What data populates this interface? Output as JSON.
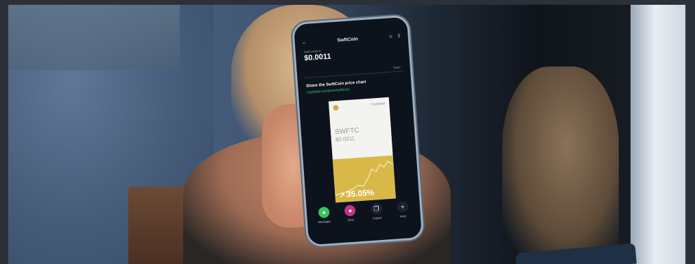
{
  "phone": {
    "app_title": "SwftCoin",
    "coin_name": "SwftCoinprice",
    "price": "$0.0011",
    "change": "",
    "share_tab": "Share",
    "share_title": "Share the SwftCoin price chart",
    "share_link": "cryptokai.com/price/swftcoin",
    "card": {
      "brand": "Cryptokai",
      "ticker": "SWFTC",
      "price": "$0.0011",
      "change_pct": "35.05%",
      "accent_color": "#d9b84a"
    },
    "actions": [
      {
        "label": "Messages",
        "icon": "messages-icon",
        "color": "#34c759"
      },
      {
        "label": "Story",
        "icon": "story-icon",
        "color": "#c13584"
      },
      {
        "label": "Copied",
        "icon": "copy-icon",
        "color": "#1c2430"
      },
      {
        "label": "More",
        "icon": "plus-icon",
        "color": "#1c2430"
      }
    ],
    "icons": {
      "back": "back-arrow-icon",
      "star": "star-icon",
      "share": "share-icon",
      "arrow_up": "arrow-up-right-icon"
    }
  }
}
